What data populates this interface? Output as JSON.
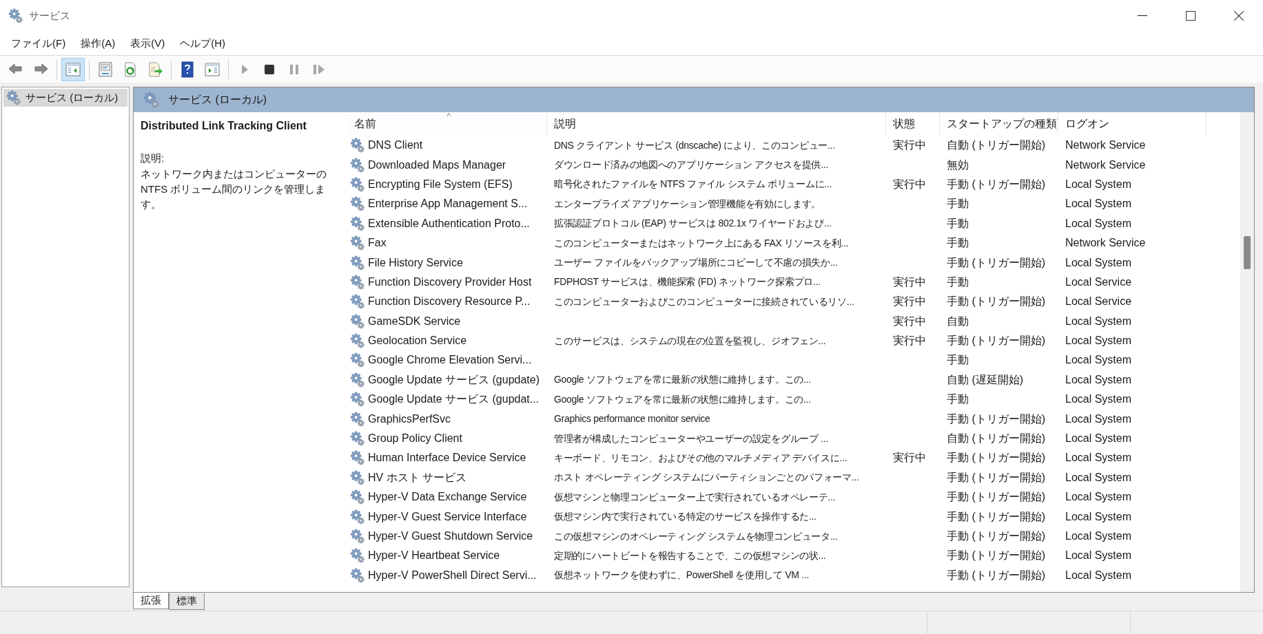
{
  "window": {
    "title": "サービス"
  },
  "menu": [
    "ファイル(F)",
    "操作(A)",
    "表示(V)",
    "ヘルプ(H)"
  ],
  "toolbar": [
    {
      "kind": "back",
      "disabled": false,
      "pressed": false
    },
    {
      "kind": "forward",
      "disabled": false,
      "pressed": false
    },
    {
      "kind": "separator"
    },
    {
      "kind": "tree-toggle",
      "disabled": false,
      "pressed": true
    },
    {
      "kind": "separator"
    },
    {
      "kind": "properties",
      "disabled": false,
      "pressed": false
    },
    {
      "kind": "refresh",
      "disabled": false,
      "pressed": false
    },
    {
      "kind": "export",
      "disabled": false,
      "pressed": false
    },
    {
      "kind": "separator"
    },
    {
      "kind": "help",
      "disabled": false,
      "pressed": false
    },
    {
      "kind": "action-pane",
      "disabled": false,
      "pressed": false
    },
    {
      "kind": "separator"
    },
    {
      "kind": "play",
      "disabled": true,
      "pressed": false
    },
    {
      "kind": "stop",
      "disabled": false,
      "pressed": false
    },
    {
      "kind": "pause",
      "disabled": true,
      "pressed": false
    },
    {
      "kind": "resume",
      "disabled": true,
      "pressed": false
    }
  ],
  "sidebar": {
    "items": [
      {
        "label": "サービス (ローカル)",
        "selected": true
      }
    ]
  },
  "panel": {
    "header": "サービス (ローカル)",
    "detail": {
      "title": "Distributed Link Tracking Client",
      "label": "説明:",
      "text": "ネットワーク内またはコンピューターの NTFS ボリューム間のリンクを管理します。"
    }
  },
  "table": {
    "columns": [
      {
        "label": "名前",
        "sorted": true
      },
      {
        "label": "説明",
        "sorted": false
      },
      {
        "label": "状態",
        "sorted": false
      },
      {
        "label": "スタートアップの種類",
        "sorted": false
      },
      {
        "label": "ログオン",
        "sorted": false
      }
    ],
    "sort_indicator": "^",
    "rows": [
      {
        "name": "DNS Client",
        "description": "DNS クライアント サービス (dnscache) により、このコンピュー...",
        "status": "実行中",
        "startup": "自動 (トリガー開始)",
        "logon": "Network Service"
      },
      {
        "name": "Downloaded Maps Manager",
        "description": "ダウンロード済みの地図へのアプリケーション アクセスを提供...",
        "startup": "無効",
        "logon": "Network Service"
      },
      {
        "name": "Encrypting File System (EFS)",
        "description": "暗号化されたファイルを NTFS ファイル システム ボリュームに...",
        "status": "実行中",
        "startup": "手動 (トリガー開始)",
        "logon": "Local System"
      },
      {
        "name": "Enterprise App Management S...",
        "description": "エンタープライズ アプリケーション管理機能を有効にします。",
        "startup": "手動",
        "logon": "Local System"
      },
      {
        "name": "Extensible Authentication Proto...",
        "description": "拡張認証プロトコル (EAP) サービスは 802.1x ワイヤードおよび...",
        "startup": "手動",
        "logon": "Local System"
      },
      {
        "name": "Fax",
        "description": "このコンピューターまたはネットワーク上にある FAX リソースを利...",
        "startup": "手動",
        "logon": "Network Service"
      },
      {
        "name": "File History Service",
        "description": "ユーザー ファイルをバックアップ場所にコピーして不慮の損失か...",
        "startup": "手動 (トリガー開始)",
        "logon": "Local System"
      },
      {
        "name": "Function Discovery Provider Host",
        "description": "FDPHOST サービスは、機能探索 (FD) ネットワーク探索プロ...",
        "status": "実行中",
        "startup": "手動",
        "logon": "Local Service"
      },
      {
        "name": "Function Discovery Resource P...",
        "description": "このコンピューターおよびこのコンピューターに接続されているリソ...",
        "status": "実行中",
        "startup": "手動 (トリガー開始)",
        "logon": "Local Service"
      },
      {
        "name": "GameSDK Service",
        "status": "実行中",
        "startup": "自動",
        "logon": "Local System"
      },
      {
        "name": "Geolocation Service",
        "description": "このサービスは、システムの現在の位置を監視し、ジオフェン...",
        "status": "実行中",
        "startup": "手動 (トリガー開始)",
        "logon": "Local System"
      },
      {
        "name": "Google Chrome Elevation Servi...",
        "startup": "手動",
        "logon": "Local System"
      },
      {
        "name": "Google Update サービス (gupdate)",
        "description": "Google ソフトウェアを常に最新の状態に維持します。この...",
        "startup": "自動 (遅延開始)",
        "logon": "Local System"
      },
      {
        "name": "Google Update サービス (gupdat...",
        "description": "Google ソフトウェアを常に最新の状態に維持します。この...",
        "startup": "手動",
        "logon": "Local System"
      },
      {
        "name": "GraphicsPerfSvc",
        "description": "Graphics performance monitor service",
        "startup": "手動 (トリガー開始)",
        "logon": "Local System"
      },
      {
        "name": "Group Policy Client",
        "description": "管理者が構成したコンピューターやユーザーの設定をグループ ...",
        "startup": "自動 (トリガー開始)",
        "logon": "Local System"
      },
      {
        "name": "Human Interface Device Service",
        "description": "キーボード、リモコン、およびその他のマルチメディア デバイスに...",
        "status": "実行中",
        "startup": "手動 (トリガー開始)",
        "logon": "Local System"
      },
      {
        "name": "HV ホスト サービス",
        "description": "ホスト オペレーティング システムにパーティションごとのパフォーマ...",
        "startup": "手動 (トリガー開始)",
        "logon": "Local System"
      },
      {
        "name": "Hyper-V Data Exchange Service",
        "description": "仮想マシンと物理コンピューター上で実行されているオペレーテ...",
        "startup": "手動 (トリガー開始)",
        "logon": "Local System"
      },
      {
        "name": "Hyper-V Guest Service Interface",
        "description": "仮想マシン内で実行されている特定のサービスを操作するた...",
        "startup": "手動 (トリガー開始)",
        "logon": "Local System"
      },
      {
        "name": "Hyper-V Guest Shutdown Service",
        "description": "この仮想マシンのオペレーティング システムを物理コンピュータ...",
        "startup": "手動 (トリガー開始)",
        "logon": "Local System"
      },
      {
        "name": "Hyper-V Heartbeat Service",
        "description": "定期的にハートビートを報告することで、この仮想マシンの状...",
        "startup": "手動 (トリガー開始)",
        "logon": "Local System"
      },
      {
        "name": "Hyper-V PowerShell Direct Servi...",
        "description": "仮想ネットワークを使わずに、PowerShell を使用して VM ...",
        "startup": "手動 (トリガー開始)",
        "logon": "Local System"
      }
    ]
  },
  "tabs": [
    {
      "label": "拡張",
      "selected": true
    },
    {
      "label": "標準",
      "selected": false
    }
  ]
}
